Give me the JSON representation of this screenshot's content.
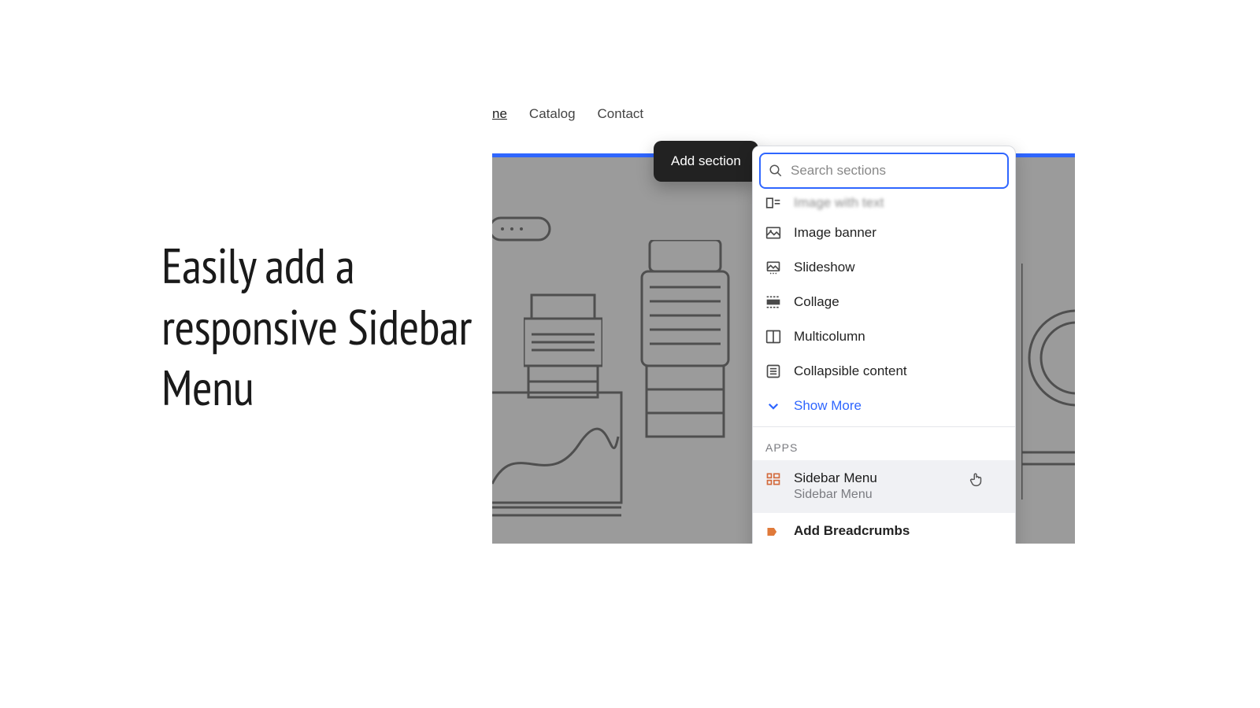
{
  "promo": {
    "headline": "Easily add a responsive Sidebar Menu"
  },
  "nav": {
    "partial": "ne",
    "items": [
      "Catalog",
      "Contact"
    ]
  },
  "tooltip": {
    "add_section": "Add section"
  },
  "panel": {
    "search_placeholder": "Search sections",
    "cut_row_label": "Image with text",
    "sections": [
      {
        "icon": "image-banner-icon",
        "label": "Image banner"
      },
      {
        "icon": "slideshow-icon",
        "label": "Slideshow"
      },
      {
        "icon": "collage-icon",
        "label": "Collage"
      },
      {
        "icon": "multicolumn-icon",
        "label": "Multicolumn"
      },
      {
        "icon": "collapsible-icon",
        "label": "Collapsible content"
      }
    ],
    "show_more": "Show More",
    "group_label": "APPS",
    "apps": [
      {
        "name": "Sidebar Menu",
        "sub": "Sidebar Menu",
        "highlighted": true
      },
      {
        "name": "Add Breadcrumbs",
        "sub": "",
        "partial": true
      }
    ]
  }
}
